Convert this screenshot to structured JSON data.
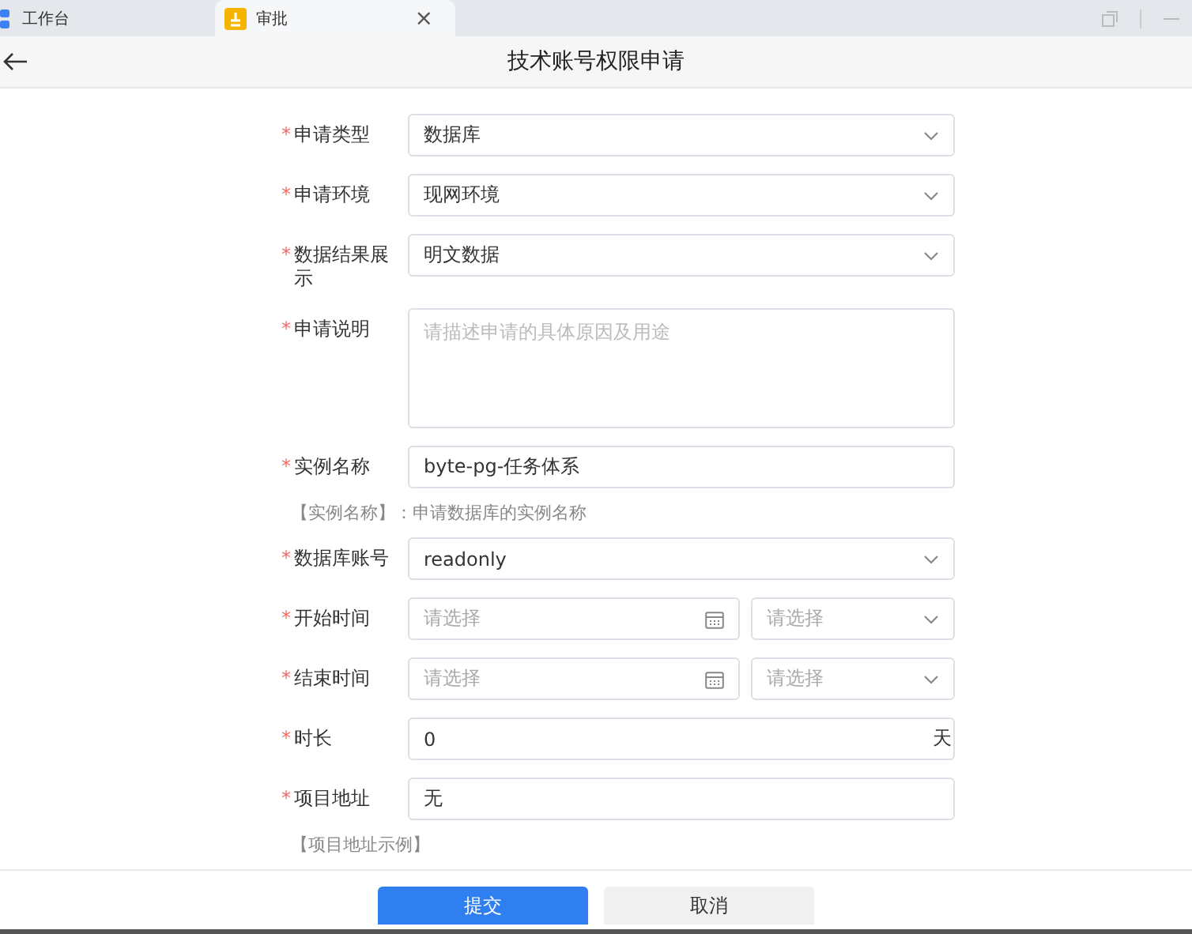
{
  "tabs": [
    {
      "label": "工作台",
      "selected": false,
      "closable": false
    },
    {
      "label": "审批",
      "selected": true,
      "closable": true,
      "close_glyph": "×"
    }
  ],
  "header": {
    "title": "技术账号权限申请"
  },
  "form": [
    {
      "kind": "select",
      "label": "申请类型",
      "required_mark": "*",
      "value": "数据库"
    },
    {
      "kind": "select",
      "label": "申请环境",
      "required_mark": "*",
      "value": "现网环境"
    },
    {
      "kind": "select",
      "label": "数据结果展示",
      "required_mark": "*",
      "value": "明文数据"
    },
    {
      "kind": "textarea",
      "label": "申请说明",
      "required_mark": "*",
      "placeholder": "请描述申请的具体原因及用途"
    },
    {
      "kind": "input",
      "label": "实例名称",
      "required_mark": "*",
      "value": "byte-pg-任务体系"
    },
    {
      "kind": "hint",
      "text": "【实例名称】：申请数据库的实例名称"
    },
    {
      "kind": "select",
      "label": "数据库账号",
      "required_mark": "*",
      "value": "readonly"
    },
    {
      "kind": "datetime",
      "label": "开始时间",
      "required_mark": "*",
      "date_placeholder": "请选择",
      "time_placeholder": "请选择"
    },
    {
      "kind": "datetime",
      "label": "结束时间",
      "required_mark": "*",
      "date_placeholder": "请选择",
      "time_placeholder": "请选择"
    },
    {
      "kind": "input",
      "label": "时长",
      "required_mark": "*",
      "value": "0",
      "suffix": "天"
    },
    {
      "kind": "input",
      "label": "项目地址",
      "required_mark": "*",
      "value": "无"
    },
    {
      "kind": "hint",
      "text": "【项目地址示例】"
    }
  ],
  "buttons": [
    {
      "label": "提交",
      "kind": "primary"
    },
    {
      "label": "取消",
      "kind": "secondary"
    }
  ]
}
